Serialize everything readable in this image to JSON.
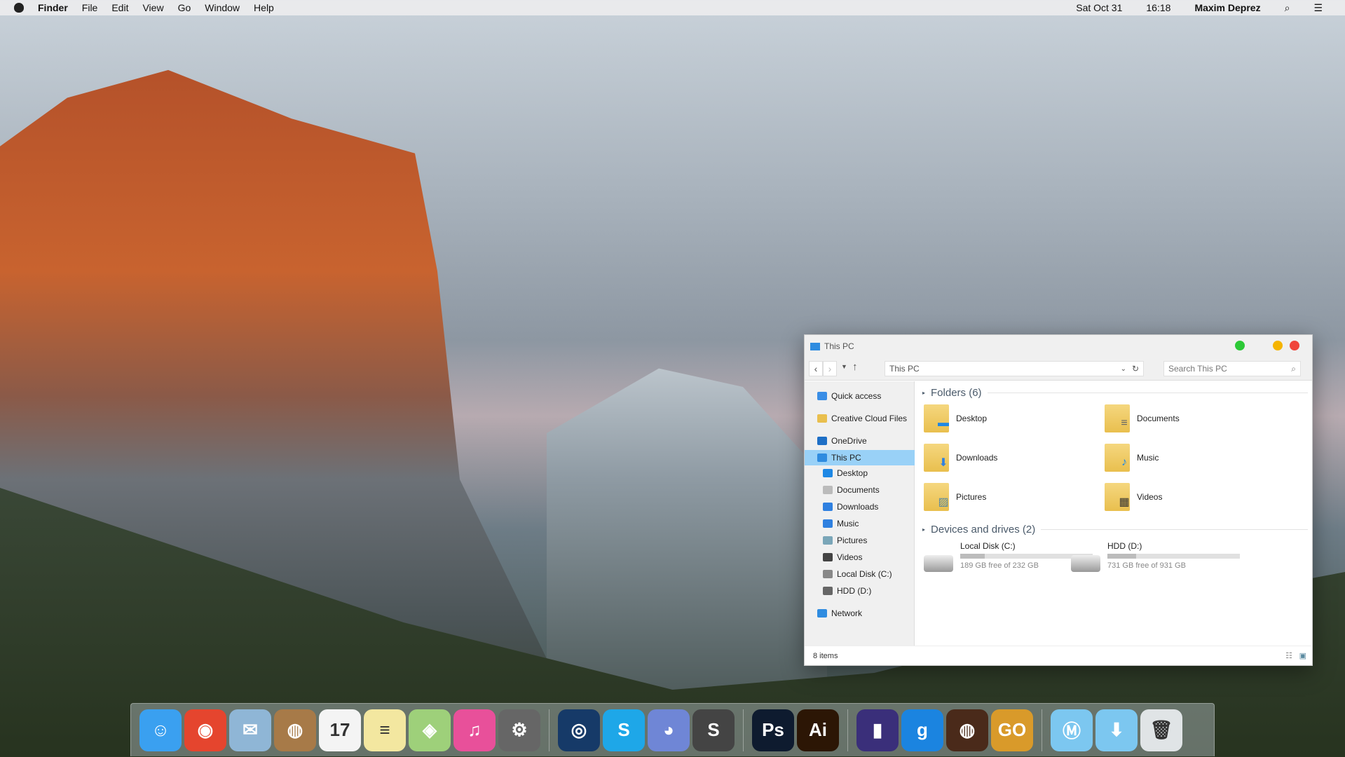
{
  "menubar": {
    "apple": "",
    "app": "Finder",
    "items": [
      "File",
      "Edit",
      "View",
      "Go",
      "Window",
      "Help"
    ],
    "date": "Sat Oct 31",
    "time": "16:18",
    "user": "Maxim Deprez"
  },
  "window": {
    "title": "This PC",
    "address": "This PC",
    "search_placeholder": "Search This PC",
    "sidebar": [
      {
        "label": "Quick access",
        "icon": "star-icon",
        "color": "#3a8ee6"
      },
      {
        "label": "Creative Cloud Files",
        "icon": "creative-cloud-folder-icon",
        "color": "#e9bf4e"
      },
      {
        "label": "OneDrive",
        "icon": "cloud-icon",
        "color": "#1e6fc6"
      },
      {
        "label": "This PC",
        "icon": "computer-icon",
        "color": "#2f8ce0",
        "selected": true
      },
      {
        "label": "Desktop",
        "icon": "desktop-icon",
        "color": "#1e88e5"
      },
      {
        "label": "Documents",
        "icon": "document-icon",
        "color": "#bbbbbb"
      },
      {
        "label": "Downloads",
        "icon": "download-icon",
        "color": "#2f80e0"
      },
      {
        "label": "Music",
        "icon": "music-icon",
        "color": "#2f80e0"
      },
      {
        "label": "Pictures",
        "icon": "picture-icon",
        "color": "#7aa6b8"
      },
      {
        "label": "Videos",
        "icon": "video-icon",
        "color": "#444444"
      },
      {
        "label": "Local Disk (C:)",
        "icon": "disk-icon",
        "color": "#888888"
      },
      {
        "label": "HDD (D:)",
        "icon": "hdd-icon",
        "color": "#666666"
      },
      {
        "label": "Network",
        "icon": "network-icon",
        "color": "#2f8ce0"
      }
    ],
    "folders_header": "Folders (6)",
    "folders": [
      {
        "label": "Desktop",
        "glyph": "▬",
        "color": "#1e88e5"
      },
      {
        "label": "Documents",
        "glyph": "≡",
        "color": "#666"
      },
      {
        "label": "Downloads",
        "glyph": "⬇",
        "color": "#2f80e0"
      },
      {
        "label": "Music",
        "glyph": "♪",
        "color": "#1e88e5"
      },
      {
        "label": "Pictures",
        "glyph": "▨",
        "color": "#5a8aa0"
      },
      {
        "label": "Videos",
        "glyph": "▦",
        "color": "#333"
      }
    ],
    "drives_header": "Devices and drives (2)",
    "drives": [
      {
        "label": "Local Disk (C:)",
        "free": "189 GB free of 232 GB",
        "used_fraction": 0.185
      },
      {
        "label": "HDD (D:)",
        "free": "731 GB free of 931 GB",
        "used_fraction": 0.215
      }
    ],
    "status": "8 items",
    "lights": [
      "#2dc937",
      "#f5b400",
      "#f0453c"
    ]
  },
  "dock": [
    {
      "name": "finder",
      "glyph": "☺",
      "color": "#3aa0f0"
    },
    {
      "name": "chrome",
      "glyph": "◉",
      "color": "#e5452e"
    },
    {
      "name": "mail",
      "glyph": "✉",
      "color": "#8fb6d6"
    },
    {
      "name": "contacts",
      "glyph": "◍",
      "color": "#a77a48"
    },
    {
      "name": "calendar",
      "glyph": "17",
      "color": "#f4f4f4"
    },
    {
      "name": "notes",
      "glyph": "≡",
      "color": "#f3e7a0"
    },
    {
      "name": "maps",
      "glyph": "◈",
      "color": "#9ed07a"
    },
    {
      "name": "itunes",
      "glyph": "♫",
      "color": "#e8509a"
    },
    {
      "name": "system-preferences",
      "glyph": "⚙",
      "color": "#666"
    },
    {
      "sep": true
    },
    {
      "name": "steam",
      "glyph": "◎",
      "color": "#163a68"
    },
    {
      "name": "skype",
      "glyph": "S",
      "color": "#1ea7e8"
    },
    {
      "name": "discord",
      "glyph": "◕",
      "color": "#6f86d6"
    },
    {
      "name": "sublime-text",
      "glyph": "S",
      "color": "#444"
    },
    {
      "sep": true
    },
    {
      "name": "photoshop",
      "glyph": "Ps",
      "color": "#0e1b2f"
    },
    {
      "name": "illustrator",
      "glyph": "Ai",
      "color": "#2c1605"
    },
    {
      "sep": true
    },
    {
      "name": "app-obsidian",
      "glyph": "▮",
      "color": "#3a2f7a"
    },
    {
      "name": "gmod",
      "glyph": "g",
      "color": "#1b84e0"
    },
    {
      "name": "tf2",
      "glyph": "◍",
      "color": "#4a2a1a"
    },
    {
      "name": "csgo",
      "glyph": "GO",
      "color": "#d99a2a"
    },
    {
      "sep": true
    },
    {
      "name": "folder-applications",
      "glyph": "Ⓜ",
      "color": "#7cc7f0"
    },
    {
      "name": "folder-downloads",
      "glyph": "⬇",
      "color": "#7cc7f0"
    },
    {
      "name": "trash",
      "glyph": "🗑",
      "color": "#e0e4e6"
    }
  ]
}
